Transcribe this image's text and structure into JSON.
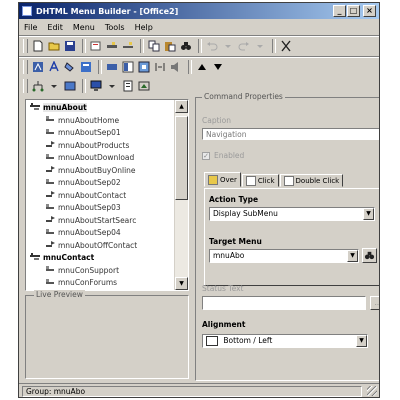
{
  "window": {
    "title": "DHTML Menu Builder - [Office2]",
    "minimize_glyph": "_",
    "maximize_glyph": "□",
    "close_glyph": "×"
  },
  "menubar": {
    "items": [
      "File",
      "Edit",
      "Menu",
      "Tools",
      "Help"
    ]
  },
  "tree": {
    "items": [
      {
        "label": "mnuAbout",
        "type": "group"
      },
      {
        "label": "mnuAboutHome",
        "type": "command"
      },
      {
        "label": "mnuAboutSep01",
        "type": "command"
      },
      {
        "label": "mnuAboutProducts",
        "type": "submenu"
      },
      {
        "label": "mnuAboutDownload",
        "type": "command"
      },
      {
        "label": "mnuAboutBuyOnline",
        "type": "submenu"
      },
      {
        "label": "mnuAboutSep02",
        "type": "command"
      },
      {
        "label": "mnuAboutContact",
        "type": "submenu"
      },
      {
        "label": "mnuAboutSep03",
        "type": "command"
      },
      {
        "label": "mnuAboutStartSearc",
        "type": "submenu"
      },
      {
        "label": "mnuAboutSep04",
        "type": "command"
      },
      {
        "label": "mnuAboutOffContact",
        "type": "submenu"
      },
      {
        "label": "mnuContact",
        "type": "group"
      },
      {
        "label": "mnuConSupport",
        "type": "command"
      },
      {
        "label": "mnuConForums",
        "type": "command"
      }
    ]
  },
  "preview": {
    "title": "Live Preview"
  },
  "properties": {
    "title": "Command Properties",
    "caption_label": "Caption",
    "caption_value": "Navigation",
    "enabled_label": "Enabled",
    "enabled_mark": "✓",
    "tabs": [
      {
        "label": "Over"
      },
      {
        "label": "Click"
      },
      {
        "label": "Double Click"
      }
    ],
    "action_type_label": "Action Type",
    "action_type_value": "Display SubMenu",
    "target_menu_label": "Target Menu",
    "target_menu_value": "mnuAbo",
    "status_text_label": "Status Text",
    "status_text_value": "",
    "status_btn_glyph": "...",
    "alignment_label": "Alignment",
    "alignment_value": "Bottom / Left"
  },
  "statusbar": {
    "text": "Group: mnuAbo"
  },
  "colors": {
    "title_start": "#0a246a",
    "title_end": "#a6caf0",
    "face": "#d4d0c8"
  }
}
